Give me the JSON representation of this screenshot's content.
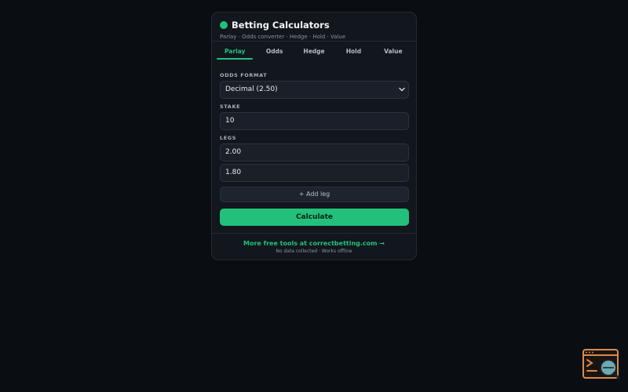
{
  "header": {
    "title": "Betting Calculators",
    "subtitle": "Parlay · Odds converter · Hedge · Hold · Value"
  },
  "tabs": [
    {
      "label": "Parlay",
      "active": true
    },
    {
      "label": "Odds",
      "active": false
    },
    {
      "label": "Hedge",
      "active": false
    },
    {
      "label": "Hold",
      "active": false
    },
    {
      "label": "Value",
      "active": false
    }
  ],
  "form": {
    "odds_format_label": "ODDS FORMAT",
    "odds_format_value": "Decimal (2.50)",
    "stake_label": "STAKE",
    "stake_value": "10",
    "legs_label": "LEGS",
    "legs": [
      "2.00",
      "1.80"
    ],
    "add_leg_label": "+ Add leg",
    "calculate_label": "Calculate"
  },
  "footer": {
    "link": "More free tools at correctbetting.com →",
    "note": "No data collected · Works offline"
  },
  "icons": {
    "brand_dot": "status-dot",
    "widget": "terminal-search-icon",
    "select_caret": "chevron-down-icon"
  },
  "colors": {
    "accent": "#22c07a",
    "background": "#0a0d12",
    "card": "#12161d"
  }
}
